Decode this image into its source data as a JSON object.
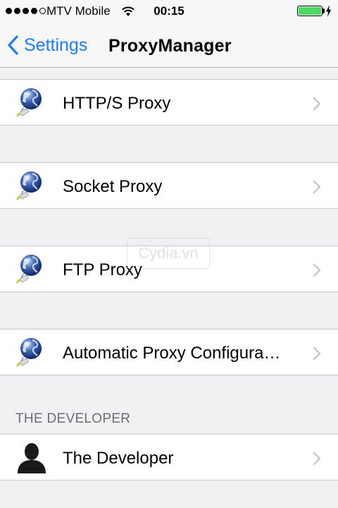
{
  "status_bar": {
    "carrier": "MTV Mobile",
    "time": "00:15",
    "signal_bars": 4,
    "signal_max": 5,
    "battery_level": 1.0,
    "battery_color": "#4cd964",
    "wifi_icon": "wifi-icon",
    "charging_icon": "lightning-bolt-icon"
  },
  "nav": {
    "back_label": "Settings",
    "title": "ProxyManager",
    "accent": "#1a7efb"
  },
  "proxy_items": [
    {
      "label": "HTTP/S Proxy",
      "icon": "network-globe-icon"
    },
    {
      "label": "Socket Proxy",
      "icon": "network-globe-icon"
    },
    {
      "label": "FTP Proxy",
      "icon": "network-globe-icon"
    },
    {
      "label": "Automatic Proxy Configura…",
      "icon": "network-globe-icon"
    }
  ],
  "developer_section": {
    "header": "THE DEVELOPER",
    "item_label": "The Developer",
    "icon": "person-silhouette-icon"
  },
  "watermark": "Cydia.vn"
}
